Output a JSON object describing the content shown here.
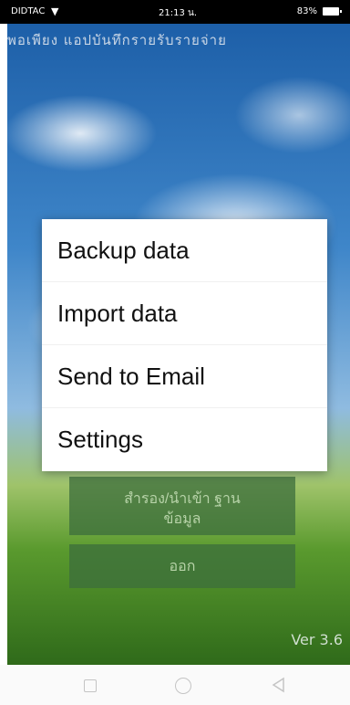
{
  "status_bar": {
    "carrier": "DIDTAC",
    "time": "21:13 น.",
    "battery": "83%"
  },
  "app": {
    "title": "พอเพียง แอปบันทึกรายรับรายจ่าย",
    "import_button_label": "สำรอง/นำเข้า ฐาน\nข้อมูล",
    "exit_button_label": "ออก",
    "version": "Ver 3.6"
  },
  "menu": {
    "items": [
      {
        "label": "Backup data"
      },
      {
        "label": "Import data"
      },
      {
        "label": "Send to Email"
      },
      {
        "label": "Settings"
      }
    ]
  },
  "nav_bar": {
    "icons": [
      "recent-apps-icon",
      "home-icon",
      "back-icon"
    ]
  }
}
